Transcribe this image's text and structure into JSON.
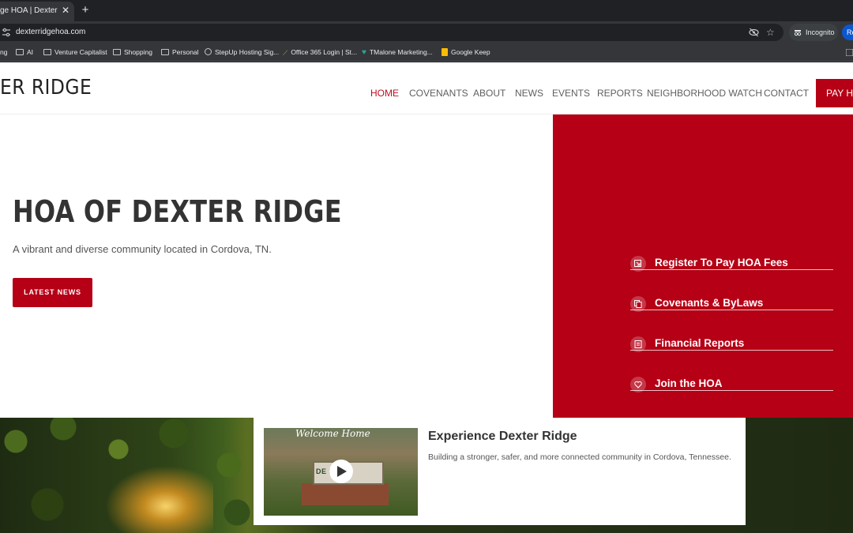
{
  "browser": {
    "tab_title": "ge HOA | Dexter Ridg",
    "tab_close": "✕",
    "new_tab": "+",
    "url": "dexterridgehoa.com",
    "star": "☆",
    "incognito_label": "Incognito",
    "relaunch_label": "Re",
    "bookmarks": [
      {
        "label": "ng",
        "icon": "none"
      },
      {
        "label": "AI",
        "icon": "folder-icon"
      },
      {
        "label": "Venture Capitalist",
        "icon": "folder-icon"
      },
      {
        "label": "Shopping",
        "icon": "folder-icon"
      },
      {
        "label": "Personal",
        "icon": "folder-icon"
      },
      {
        "label": "StepUp Hosting Sig...",
        "icon": "globe-icon"
      },
      {
        "label": "Office 365 Login | St...",
        "icon": "leaf-icon"
      },
      {
        "label": "TMalone Marketing...",
        "icon": "tm-icon"
      },
      {
        "label": "Google Keep",
        "icon": "keep-icon"
      }
    ]
  },
  "site": {
    "logo": "ER RIDGE",
    "nav": [
      "HOME",
      "COVENANTS",
      "ABOUT",
      "NEWS",
      "EVENTS",
      "REPORTS",
      "NEIGHBORHOOD WATCH",
      "CONTACT"
    ],
    "pay_button": "PAY HOA",
    "hero": {
      "title": "HOA OF DEXTER RIDGE",
      "subtitle": "A vibrant and diverse community located in Cordova, TN.",
      "cta": "LATEST NEWS"
    },
    "quick_links": [
      {
        "label": "Register To Pay HOA Fees",
        "icon": "external-link-icon"
      },
      {
        "label": "Covenants & ByLaws",
        "icon": "copy-icon"
      },
      {
        "label": "Financial Reports",
        "icon": "document-icon"
      },
      {
        "label": "Join the HOA",
        "icon": "heart-icon"
      }
    ],
    "feature_card": {
      "thumb_welcome": "Welcome Home",
      "thumb_sign": "DE    RIDGE",
      "title": "Experience Dexter Ridge",
      "text": "Building a stronger, safer, and more connected community in Cordova, Tennessee."
    },
    "colors": {
      "brand_red": "#b50015",
      "nav_active": "#c00d1e",
      "text_dark": "#333333"
    }
  }
}
